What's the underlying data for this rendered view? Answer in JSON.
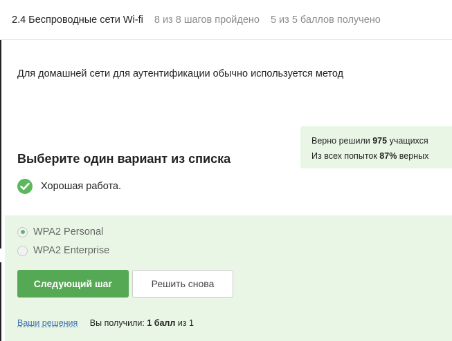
{
  "header": {
    "title": "2.4 Беспроводные сети Wi-fi",
    "steps": "8 из 8 шагов пройдено",
    "score": "5 из 5 баллов  получено"
  },
  "question": "Для домашней сети для аутентификации обычно используется метод",
  "stats": {
    "line1_prefix": "Верно решили ",
    "line1_count": "975",
    "line1_suffix": " учащихся",
    "line2_prefix": "Из всех попыток ",
    "line2_percent": "87%",
    "line2_suffix": " верных"
  },
  "instruction": "Выберите один вариант из списка",
  "feedback": "Хорошая работа.",
  "options": [
    {
      "label": "WPA2 Personal",
      "selected": true
    },
    {
      "label": "WPA2 Enterprise",
      "selected": false
    }
  ],
  "buttons": {
    "next": "Следующий шаг",
    "retry": "Решить снова"
  },
  "footer": {
    "solutions_link": "Ваши решения",
    "received_prefix": "Вы получили: ",
    "received_value": "1 балл",
    "received_suffix": " из 1"
  },
  "colors": {
    "accent_green": "#55a854",
    "panel_bg": "#e9f6e5",
    "link": "#3a6fb0"
  },
  "icons": [
    "check-circle-icon"
  ]
}
